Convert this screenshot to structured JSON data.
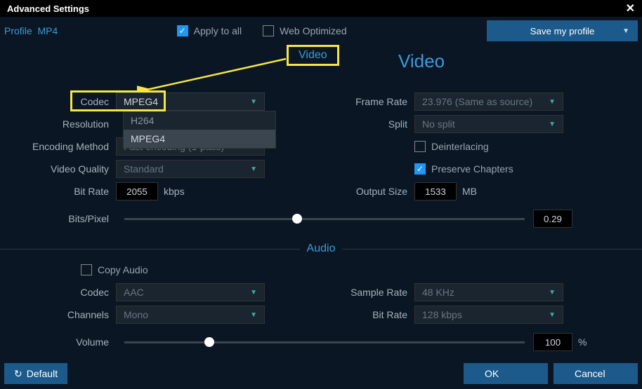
{
  "window": {
    "title": "Advanced Settings"
  },
  "profile": {
    "label": "Profile",
    "value": "MP4"
  },
  "topbar": {
    "apply_all": "Apply to all",
    "web_opt": "Web Optimized",
    "save_profile": "Save my profile"
  },
  "annot": {
    "video": "Video"
  },
  "sections": {
    "video": "Video",
    "audio": "Audio"
  },
  "labels": {
    "codec": "Codec",
    "resolution": "Resolution",
    "encoding": "Encoding Method",
    "vquality": "Video Quality",
    "bitrate": "Bit Rate",
    "bitspixel": "Bits/Pixel",
    "framerate": "Frame Rate",
    "split": "Split",
    "deinterlace": "Deinterlacing",
    "preservech": "Preserve Chapters",
    "outsize": "Output Size",
    "copyaudio": "Copy Audio",
    "channels": "Channels",
    "samplerate": "Sample Rate",
    "volume": "Volume",
    "acodec": "Codec",
    "abitrate": "Bit Rate"
  },
  "values": {
    "codec": "MPEG4",
    "codec_options": [
      "H264",
      "MPEG4"
    ],
    "encoding": "Fast encoding (1-pass)",
    "vquality": "Standard",
    "bitrate": "2055",
    "bitrate_unit": "kbps",
    "bitspixel": "0.29",
    "framerate": "23.976 (Same as source)",
    "split": "No split",
    "outsize": "1533",
    "outsize_unit": "MB",
    "acodec": "AAC",
    "channels": "Mono",
    "samplerate": "48 KHz",
    "abitrate": "128 kbps",
    "volume": "100",
    "volume_unit": "%"
  },
  "buttons": {
    "default": "Default",
    "ok": "OK",
    "cancel": "Cancel"
  },
  "checks": {
    "apply_all": true,
    "web_opt": false,
    "deinterlace": false,
    "preservech": true,
    "copyaudio": false
  }
}
